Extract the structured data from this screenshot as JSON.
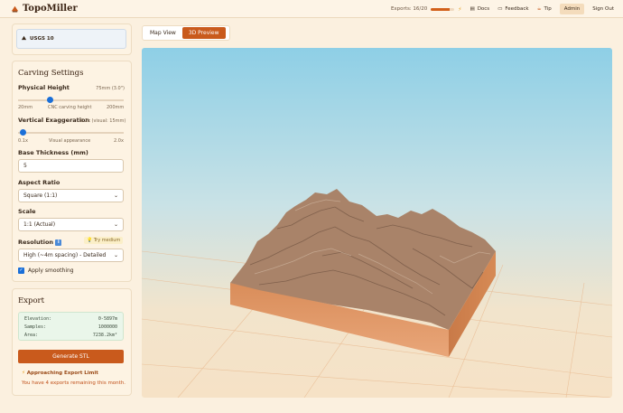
{
  "app": {
    "name": "TopoMiller"
  },
  "header": {
    "exports_label": "Exports: 16/20",
    "exports_fraction": 0.8,
    "docs": "Docs",
    "feedback": "Feedback",
    "tip": "Tip",
    "admin": "Admin",
    "signout": "Sign Out"
  },
  "source": {
    "label": "USGS 10"
  },
  "carving": {
    "title": "Carving Settings",
    "physical_height": {
      "label": "Physical Height",
      "value_text": "75mm (3.0\")",
      "min": "20mm",
      "mid": "CNC carving height",
      "max": "200mm",
      "fraction": 0.3
    },
    "vertical_exag": {
      "label": "Vertical Exaggeration",
      "value_text": "0.2x (visual: 15mm)",
      "min": "0.1x",
      "mid": "Visual appearance",
      "max": "2.0x",
      "fraction": 0.05
    },
    "base_thickness": {
      "label": "Base Thickness (mm)",
      "value": "5"
    },
    "aspect_ratio": {
      "label": "Aspect Ratio",
      "value": "Square (1:1)"
    },
    "scale": {
      "label": "Scale",
      "value": "1:1 (Actual)"
    },
    "resolution": {
      "label": "Resolution",
      "hint": "Try medium",
      "value": "High (~4m spacing) - Detailed"
    },
    "smoothing": {
      "label": "Apply smoothing",
      "checked": true
    }
  },
  "export": {
    "title": "Export",
    "elevation_label": "Elevation:",
    "elevation": "0-5897m",
    "samples_label": "Samples:",
    "samples": "1000000",
    "area_label": "Area:",
    "area": "7238.2km²",
    "generate": "Generate STL",
    "warning_title": "Approaching Export Limit",
    "warning_body": "You have 4 exports remaining this month."
  },
  "tabs": {
    "map": "Map View",
    "preview": "3D Preview"
  },
  "colors": {
    "accent": "#c95a1c",
    "terrain": "#a98369",
    "base": "#e9a679"
  }
}
